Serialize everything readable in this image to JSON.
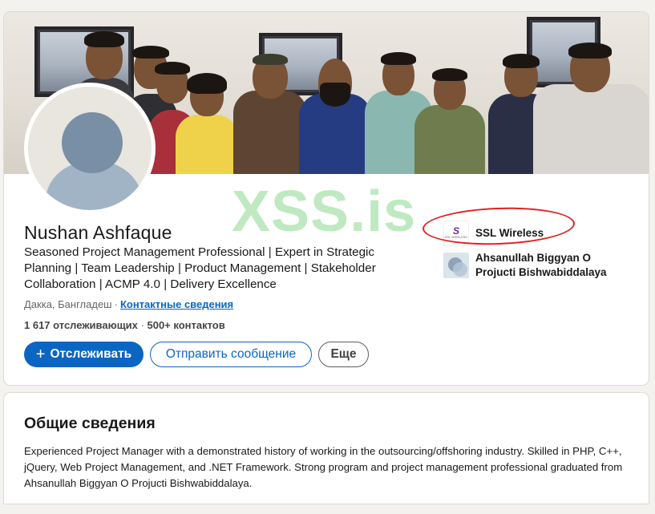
{
  "profile": {
    "name": "Nushan Ashfaque",
    "headline": "Seasoned Project Management Professional | Expert in Strategic Planning | Team Leadership | Product Management | Stakeholder Collaboration | ACMP 4.0 | Delivery Excellence",
    "location": "Дакка, Бангладеш",
    "separator": "·",
    "contact_link": "Контактные сведения",
    "followers": "1 617 отслеживающих",
    "connections_prefix": "·",
    "connections": "500+ контактов"
  },
  "actions": {
    "follow_icon": "+",
    "follow_label": "Отслеживать",
    "message_label": "Отправить сообщение",
    "more_label": "Еще"
  },
  "companies": [
    {
      "name": "SSL Wireless",
      "logo_icon": "ssl-wireless-logo",
      "logo_mark": "S",
      "logo_text": "SSL WIRELESS"
    },
    {
      "name": "Ahsanullah Biggyan O Projucti Bishwabiddalaya",
      "logo_icon": "university-logo"
    }
  ],
  "watermark": "XSS.is",
  "about": {
    "title": "Общие сведения",
    "text": "Experienced Project Manager with a demonstrated history of working in the outsourcing/offshoring industry. Skilled in PHP, C++, jQuery, Web Project Management, and .NET Framework. Strong program and project management professional graduated from Ahsanullah Biggyan O Projucti Bishwabiddalaya."
  },
  "colors": {
    "primary": "#0a66c2",
    "annotation_red": "#e0211f",
    "watermark_green": "#8bd88f",
    "page_bg": "#f4f2ee"
  }
}
